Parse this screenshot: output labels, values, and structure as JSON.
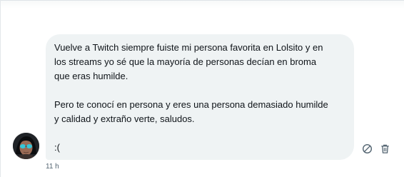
{
  "conversation": {
    "message": {
      "paragraph_1": [
        "Vuelve a Twitch siempre fuiste mi persona favorita en Lolsito y en",
        "los streams yo sé que la mayoría de personas decían en broma",
        "que eras humilde."
      ],
      "paragraph_2": [
        "Pero te conocí en persona y eres una persona demasiado humilde",
        "y calidad y extraño verte, saludos."
      ],
      "paragraph_3": ":(",
      "timestamp": "11 h"
    },
    "actions": {
      "report_icon": "block-icon",
      "delete_icon": "trash-icon"
    }
  },
  "colors": {
    "bubble_bg": "#eff3f4",
    "text": "#0f1419",
    "muted": "#536471"
  }
}
